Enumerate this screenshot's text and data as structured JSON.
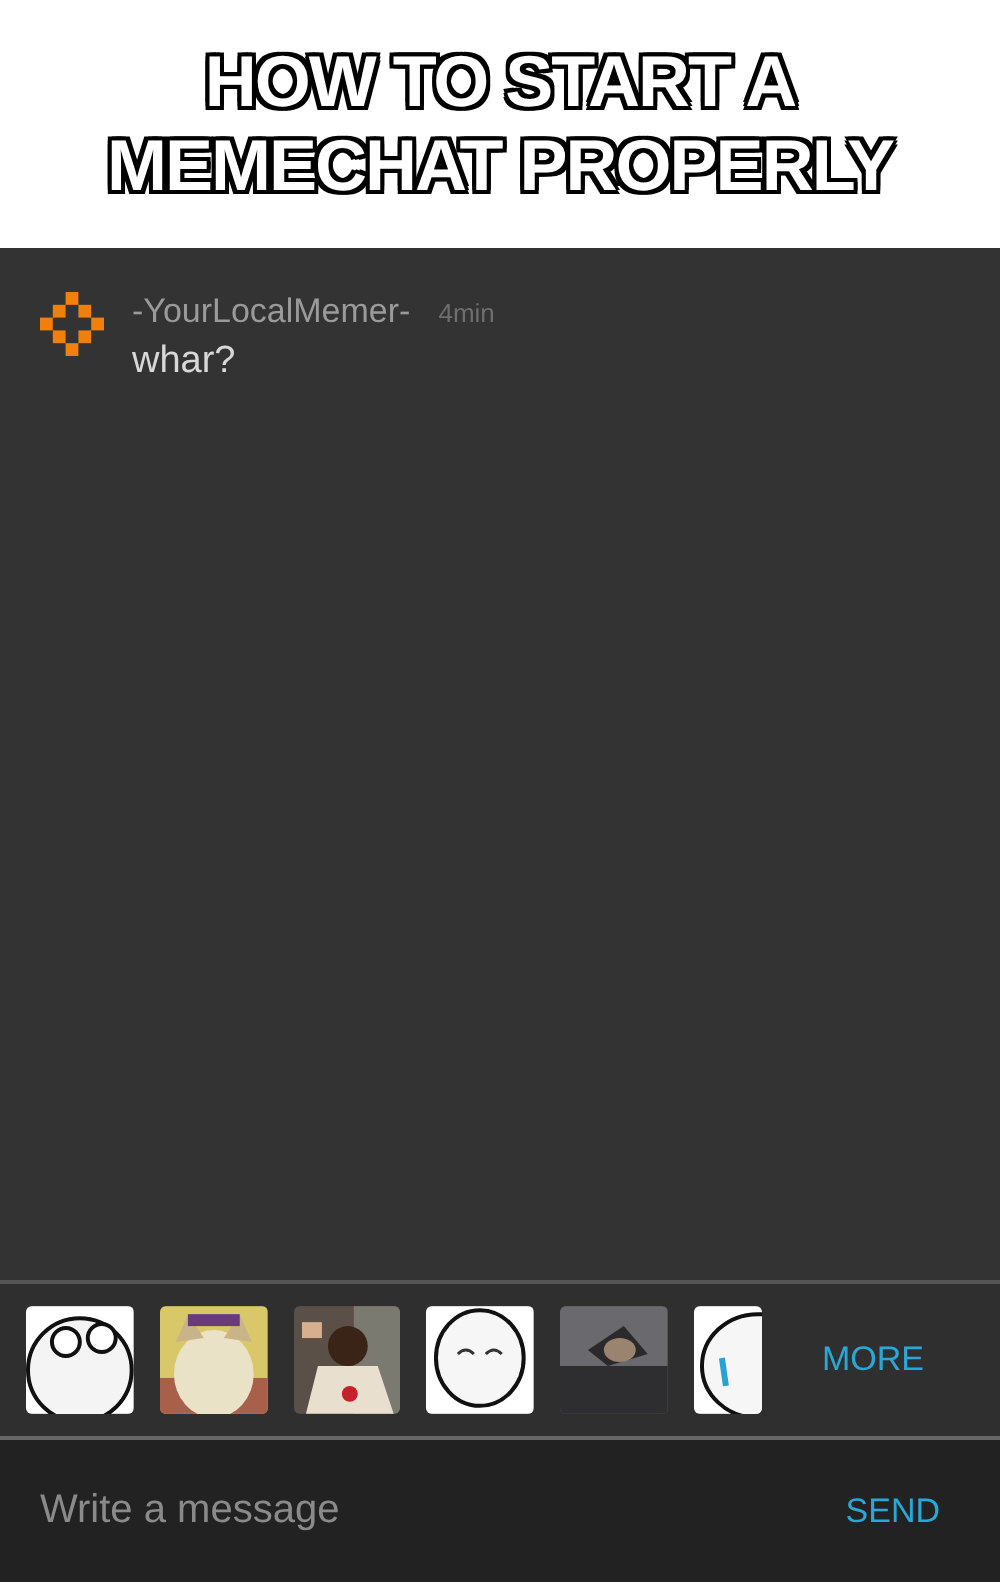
{
  "caption": "HOW TO START A MEMECHAT PROPERLY",
  "messages": [
    {
      "author": "-YourLocalMemer-",
      "time": "4min",
      "text": "whar?"
    }
  ],
  "more_button": "MORE",
  "composer": {
    "placeholder": "Write a message",
    "send": "SEND"
  }
}
